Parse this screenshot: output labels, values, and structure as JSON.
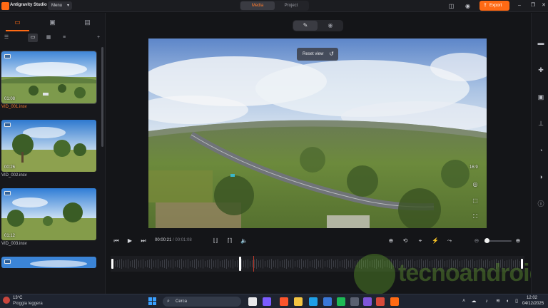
{
  "app": {
    "name": "Antigravity Studio",
    "menu_label": "Menu"
  },
  "mode_tabs": [
    {
      "label": "Media",
      "active": true
    },
    {
      "label": "Project",
      "active": false
    }
  ],
  "header": {
    "export_label": "Export"
  },
  "clips": [
    {
      "duration": "01:08",
      "name": "VID_001.insv",
      "selected": true
    },
    {
      "duration": "00:26",
      "name": "VID_002.insv",
      "selected": false
    },
    {
      "duration": "01:12",
      "name": "VID_003.insv",
      "selected": false
    },
    {
      "duration": "",
      "name": "",
      "selected": false
    }
  ],
  "viewer": {
    "reset_label": "Reset view",
    "aspect_ratio": "16:9"
  },
  "playback": {
    "current_time": "00:00:21",
    "separator": " / ",
    "total_time": "00:01:08",
    "progress_fraction": 0.31,
    "zoom_fraction": 0.08
  },
  "watermark": {
    "text": "tecnoandroid"
  },
  "taskbar": {
    "weather_temp": "13°C",
    "weather_desc": "Pioggia leggera",
    "search_placeholder": "Cerca",
    "clock_time": "12:02",
    "clock_date": "04/12/2025"
  },
  "colors": {
    "accent": "#ff6a14",
    "background": "#141518",
    "panel": "#17181c"
  }
}
